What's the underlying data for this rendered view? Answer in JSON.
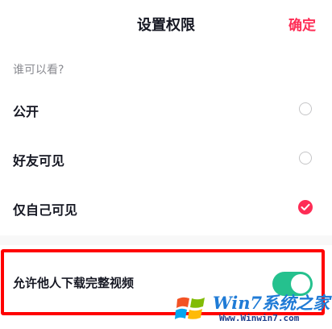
{
  "header": {
    "title": "设置权限",
    "confirm_label": "确定"
  },
  "visibility": {
    "section_label": "谁可以看?",
    "options": [
      {
        "label": "公开",
        "selected": false
      },
      {
        "label": "好友可见",
        "selected": false
      },
      {
        "label": "仅自己可见",
        "selected": true
      }
    ]
  },
  "download": {
    "label": "允许他人下载完整视频",
    "enabled": true
  },
  "watermark": {
    "name": "Win7系统之家",
    "url": "Www.Winwin7.com"
  },
  "colors": {
    "accent": "#fe2c55",
    "toggle_on": "#25c18e",
    "highlight": "#ff0000"
  }
}
